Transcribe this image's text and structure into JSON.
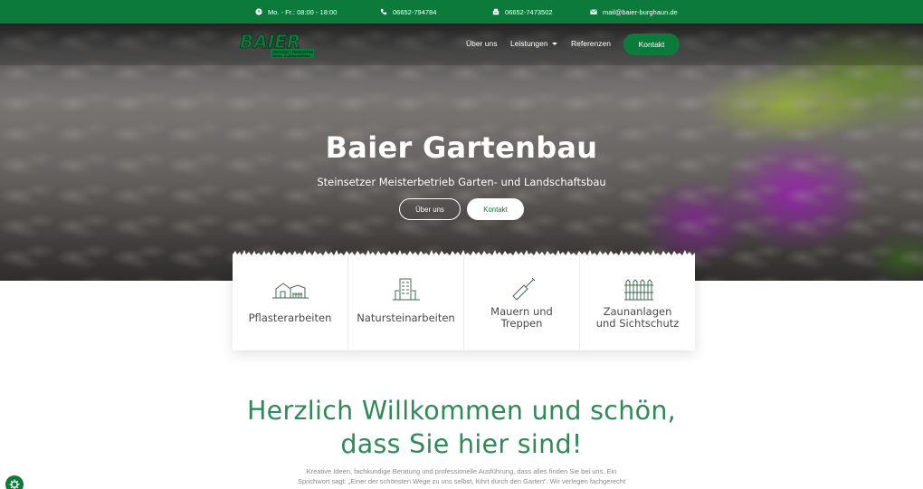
{
  "colors": {
    "brand_green": "#0b7a3b",
    "heading_green": "#2e8a57",
    "text_gray": "#4a4a4a",
    "white": "#ffffff"
  },
  "topbar": {
    "hours": {
      "icon": "clock-icon",
      "text": "Mo. - Fr.: 08:00 - 18:00"
    },
    "phone": {
      "icon": "phone-icon",
      "text": "06652-794784"
    },
    "fax": {
      "icon": "fax-icon",
      "text": "06652-7473502"
    },
    "email": {
      "icon": "mail-icon",
      "text": "mail@baier-burghaun.de"
    }
  },
  "header": {
    "logo": {
      "name": "BAIER",
      "line1": "Steinsetzer • Meisterbetrieb",
      "line2": "Garten- & Landschaftsbau"
    },
    "nav": {
      "about": "Über uns",
      "services": "Leistungen",
      "references": "Referenzen",
      "contact": "Kontakt"
    }
  },
  "hero": {
    "title": "Baier Gartenbau",
    "subtitle": "Steinsetzer Meisterbetrieb Garten- und Landschaftsbau",
    "btn_about": "Über uns",
    "btn_contact": "Kontakt"
  },
  "services": [
    {
      "icon": "house-fence-icon",
      "line1": "Pflasterarbeiten",
      "line2": ""
    },
    {
      "icon": "building-icon",
      "line1": "Natursteinarbeiten",
      "line2": ""
    },
    {
      "icon": "trowel-icon",
      "line1": "Mauern und",
      "line2": "Treppen"
    },
    {
      "icon": "fence-icon",
      "line1": "Zaunanlagen",
      "line2": "und Sichtschutz"
    }
  ],
  "welcome": {
    "line1": "Herzlich Willkommen und schön,",
    "line2": "dass Sie hier sind!",
    "intro_line1": "Kreative Ideen, fachkundige Beratung und professionelle Ausführung, dass alles finden Sie bei uns. Ein",
    "intro_line2": "Sprichwort sagt: „Einer der schönsten Wege zu uns selbst, führt durch den Garten“. Wir verlegen fachgerecht"
  },
  "cookie": {
    "icon": "cookie-settings-icon"
  }
}
